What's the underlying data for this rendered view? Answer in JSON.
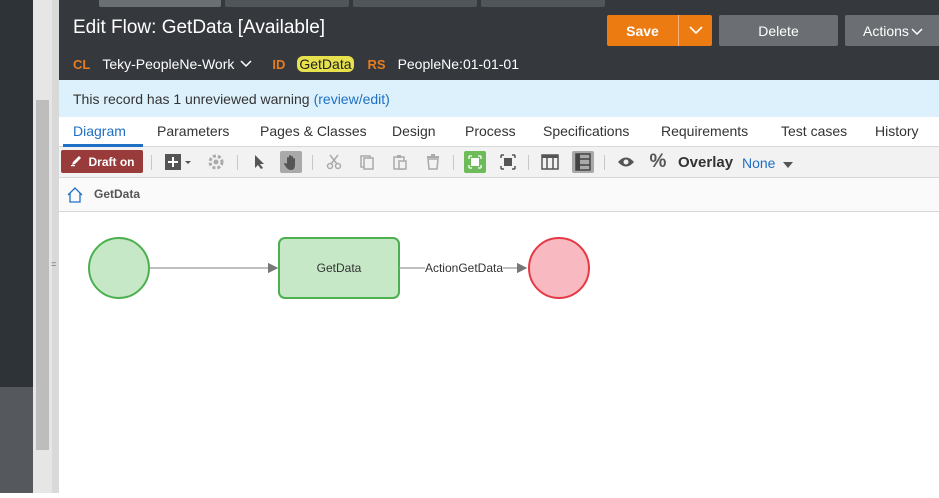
{
  "window": {
    "title": "Edit Flow: GetData [Available]"
  },
  "meta": {
    "class_key": "CL",
    "class_value": "Teky-PeopleNe-Work",
    "id_key": "ID",
    "id_value": "GetData",
    "ruleset_key": "RS",
    "ruleset_value": "PeopleNe:01-01-01"
  },
  "actions": {
    "save_label": "Save",
    "delete_label": "Delete",
    "actions_label": "Actions"
  },
  "warning": {
    "text": "This record has 1 unreviewed warning",
    "link": "(review/edit)"
  },
  "tabs": [
    {
      "label": "Diagram",
      "active": true
    },
    {
      "label": "Parameters"
    },
    {
      "label": "Pages & Classes"
    },
    {
      "label": "Design"
    },
    {
      "label": "Process"
    },
    {
      "label": "Specifications"
    },
    {
      "label": "Requirements"
    },
    {
      "label": "Test cases"
    },
    {
      "label": "History"
    }
  ],
  "toolbar": {
    "draft_label": "Draft on",
    "overlay_label": "Overlay",
    "overlay_value": "None",
    "icons": [
      "add-shape-icon",
      "settings-icon",
      "pointer-icon",
      "hand-icon",
      "cut-icon",
      "copy-icon",
      "paste-icon",
      "delete-icon",
      "fit-icon",
      "zoom-icon",
      "columns-icon",
      "rows-icon",
      "eye-icon",
      "percent-icon"
    ]
  },
  "breadcrumb": {
    "label": "GetData"
  },
  "diagram": {
    "start_node": "start",
    "utility_node": "GetData",
    "connector_label": "ActionGetData",
    "end_node": "end"
  },
  "colors": {
    "header_bg": "#35393e",
    "accent_orange": "#ec7b12",
    "link_blue": "#1f6fc5",
    "start_fill": "#c6e8c6",
    "start_stroke": "#4caf50",
    "end_fill": "#f9b9c0",
    "end_stroke": "#e53945"
  }
}
